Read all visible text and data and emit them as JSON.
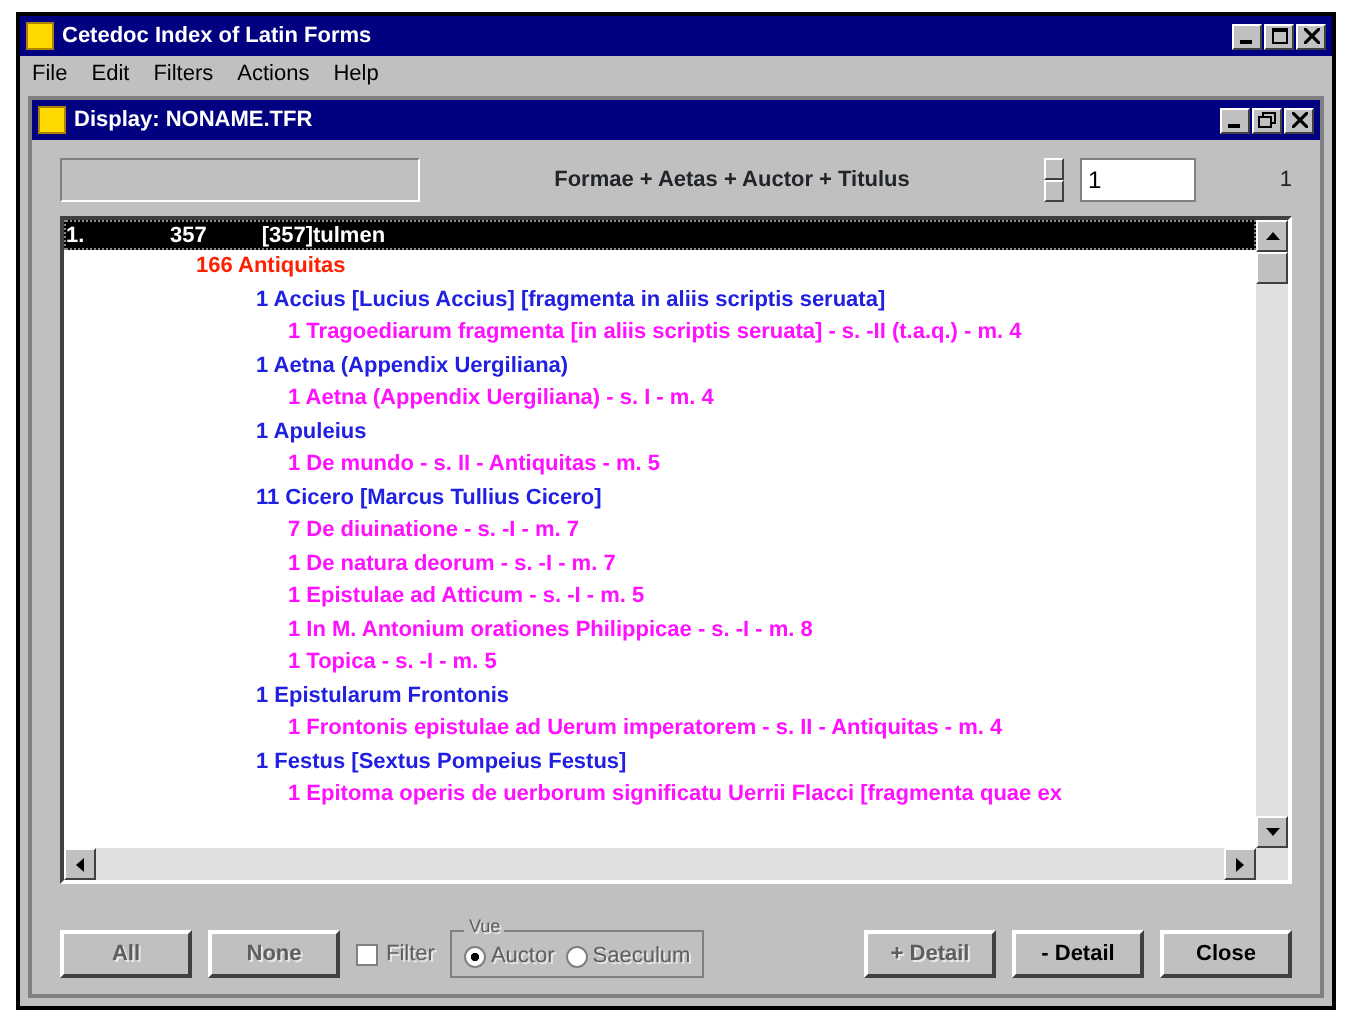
{
  "app_window": {
    "title": "Cetedoc Index of Latin Forms"
  },
  "menu": [
    {
      "label": "File"
    },
    {
      "label": "Edit"
    },
    {
      "label": "Filters"
    },
    {
      "label": "Actions"
    },
    {
      "label": "Help"
    }
  ],
  "display_window": {
    "title": "Display: NONAME.TFR"
  },
  "header": {
    "title": "Formae + Aetas + Auctor + Titulus",
    "spinner_value": "1",
    "count": "1"
  },
  "selected_row": {
    "number": "1.",
    "frequency": "357",
    "form": "[357]tulmen",
    "selected": true
  },
  "tree": [
    {
      "count": "166",
      "label": "Antiquitas",
      "children": [
        {
          "count": "1",
          "label": "Accius [Lucius Accius] [fragmenta in aliis scriptis seruata]",
          "children": [
            {
              "count": "1",
              "label": "Tragoediarum fragmenta [in aliis scriptis seruata] - s. -II (t.a.q.) - m. 4"
            }
          ]
        },
        {
          "count": "1",
          "label": "Aetna (Appendix Uergiliana)",
          "children": [
            {
              "count": "1",
              "label": "Aetna (Appendix Uergiliana) - s. I - m. 4"
            }
          ]
        },
        {
          "count": "1",
          "label": "Apuleius",
          "children": [
            {
              "count": "1",
              "label": "De mundo - s. II - Antiquitas - m. 5"
            }
          ]
        },
        {
          "count": "11",
          "label": "Cicero [Marcus Tullius Cicero]",
          "children": [
            {
              "count": "7",
              "label": "De diuinatione - s. -I - m. 7"
            },
            {
              "count": "1",
              "label": "De natura deorum - s. -I - m. 7"
            },
            {
              "count": "1",
              "label": "Epistulae ad Atticum - s. -I - m. 5"
            },
            {
              "count": "1",
              "label": "In M. Antonium orationes Philippicae - s. -I - m. 8"
            },
            {
              "count": "1",
              "label": "Topica - s. -I - m. 5"
            }
          ]
        },
        {
          "count": "1",
          "label": "Epistularum Frontonis",
          "children": [
            {
              "count": "1",
              "label": "Frontonis epistulae ad Uerum imperatorem - s. II - Antiquitas - m. 4"
            }
          ]
        },
        {
          "count": "1",
          "label": "Festus [Sextus Pompeius Festus]",
          "children": [
            {
              "count": "1",
              "label": "Epitoma operis de uerborum significatu Uerrii Flacci [fragmenta quae ex"
            }
          ]
        }
      ]
    }
  ],
  "footer": {
    "buttons": [
      {
        "label": "All",
        "disabled": true
      },
      {
        "label": "None",
        "disabled": true
      }
    ],
    "filter": {
      "label": "Filter",
      "checked": false,
      "disabled": true
    },
    "group": {
      "label": "Vue",
      "disabled": true,
      "options": [
        {
          "label": "Auctor",
          "selected": true
        },
        {
          "label": "Saeculum",
          "selected": false
        }
      ]
    },
    "actions": [
      {
        "label": "+ Detail",
        "disabled": true
      },
      {
        "label": "- Detail",
        "disabled": false
      },
      {
        "label": "Close",
        "disabled": false
      }
    ]
  }
}
